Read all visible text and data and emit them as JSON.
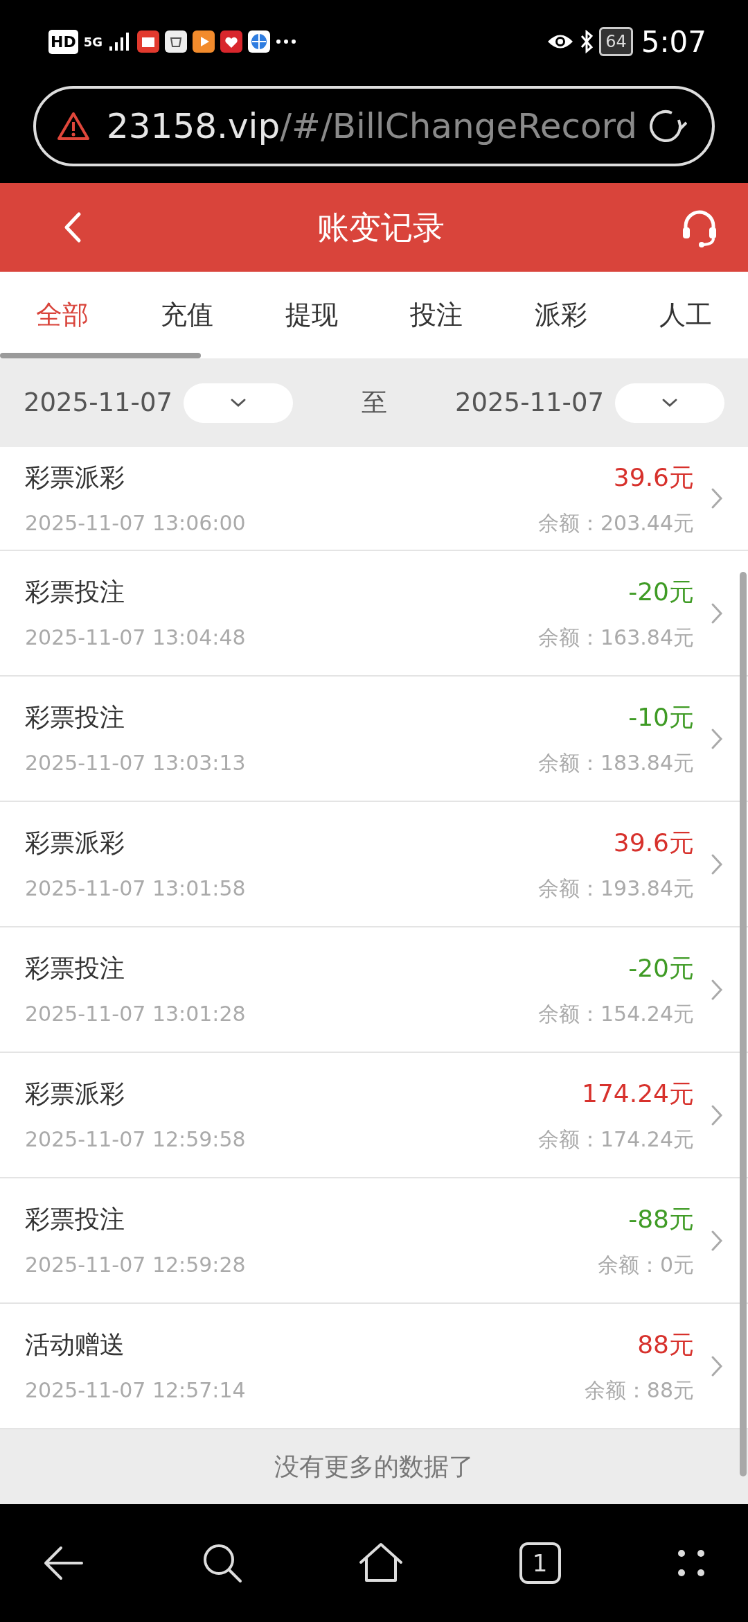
{
  "status_bar": {
    "network": "HD",
    "signal": "5G",
    "battery": "64",
    "time": "5:07"
  },
  "address_bar": {
    "domain": "23158.vip",
    "path": "/#/BillChangeRecord"
  },
  "header": {
    "title": "账变记录"
  },
  "tabs": [
    {
      "label": "全部",
      "selected": true
    },
    {
      "label": "充值",
      "selected": false
    },
    {
      "label": "提现",
      "selected": false
    },
    {
      "label": "投注",
      "selected": false
    },
    {
      "label": "派彩",
      "selected": false
    },
    {
      "label": "人工",
      "selected": false
    }
  ],
  "date_range": {
    "start": "2025-11-07",
    "separator": "至",
    "end": "2025-11-07"
  },
  "records": [
    {
      "title": "彩票派彩",
      "time": "2025-11-07 13:06:00",
      "amount": "39.6元",
      "kind": "income",
      "balance": "余额：203.44元"
    },
    {
      "title": "彩票投注",
      "time": "2025-11-07 13:04:48",
      "amount": "-20元",
      "kind": "expense",
      "balance": "余额：163.84元"
    },
    {
      "title": "彩票投注",
      "time": "2025-11-07 13:03:13",
      "amount": "-10元",
      "kind": "expense",
      "balance": "余额：183.84元"
    },
    {
      "title": "彩票派彩",
      "time": "2025-11-07 13:01:58",
      "amount": "39.6元",
      "kind": "income",
      "balance": "余额：193.84元"
    },
    {
      "title": "彩票投注",
      "time": "2025-11-07 13:01:28",
      "amount": "-20元",
      "kind": "expense",
      "balance": "余额：154.24元"
    },
    {
      "title": "彩票派彩",
      "time": "2025-11-07 12:59:58",
      "amount": "174.24元",
      "kind": "income",
      "balance": "余额：174.24元"
    },
    {
      "title": "彩票投注",
      "time": "2025-11-07 12:59:28",
      "amount": "-88元",
      "kind": "expense",
      "balance": "余额：0元"
    },
    {
      "title": "活动赠送",
      "time": "2025-11-07 12:57:14",
      "amount": "88元",
      "kind": "income",
      "balance": "余额：88元"
    }
  ],
  "footer": {
    "message": "没有更多的数据了"
  },
  "browser_nav": {
    "tab_count": "1"
  }
}
